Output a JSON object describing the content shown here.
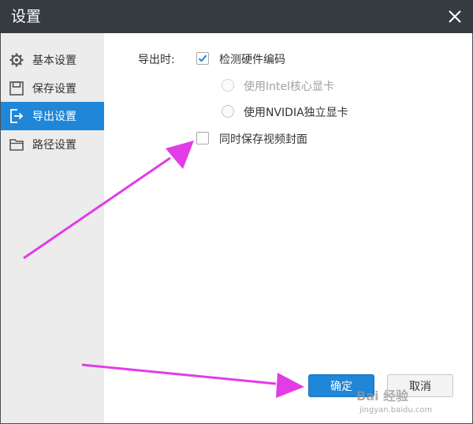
{
  "window": {
    "title": "设置"
  },
  "sidebar": {
    "items": [
      {
        "label": "基本设置",
        "icon": "gear-icon",
        "active": false
      },
      {
        "label": "保存设置",
        "icon": "save-icon",
        "active": false
      },
      {
        "label": "导出设置",
        "icon": "export-icon",
        "active": true
      },
      {
        "label": "路径设置",
        "icon": "folder-icon",
        "active": false
      }
    ]
  },
  "export_settings": {
    "section_label": "导出时:",
    "hardware_encode": {
      "label": "检测硬件编码",
      "checked": true
    },
    "intel_gpu": {
      "label": "使用Intel核心显卡",
      "selected": false,
      "disabled": true
    },
    "nvidia_gpu": {
      "label": "使用NVIDIA独立显卡",
      "selected": false,
      "disabled": false
    },
    "save_cover": {
      "label": "同时保存视频封面",
      "checked": false
    }
  },
  "buttons": {
    "ok": "确定",
    "cancel": "取消"
  },
  "watermark": {
    "brand": "Bai 经验",
    "url": "jingyan.baidu.com"
  },
  "colors": {
    "titlebar": "#363b42",
    "accent": "#1f86d8",
    "sidebar": "#ececec",
    "annotation_arrow": "#e23ce6"
  }
}
